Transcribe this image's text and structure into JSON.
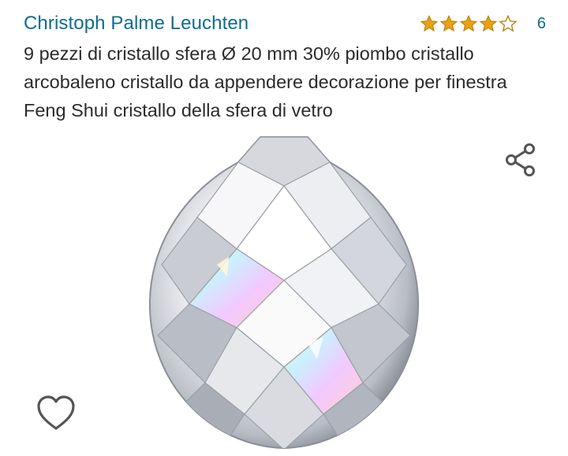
{
  "product": {
    "brand": "Christoph Palme Leuchten",
    "rating": {
      "value": 4,
      "max": 5,
      "review_count": "6"
    },
    "title": "9 pezzi di cristallo sfera Ø 20 mm 30% piombo cristallo arcobaleno cristallo da appendere decorazione per finestra Feng Shui cristallo della sfera di vetro",
    "image": {
      "subject": "crystal-ball-icon"
    }
  },
  "actions": {
    "share_icon": "share-icon",
    "wishlist_icon": "heart-icon"
  },
  "colors": {
    "brand_link": "#0f6c8f",
    "star": "#e8a212",
    "title_text": "#2b2b2b",
    "icon": "#555555"
  }
}
